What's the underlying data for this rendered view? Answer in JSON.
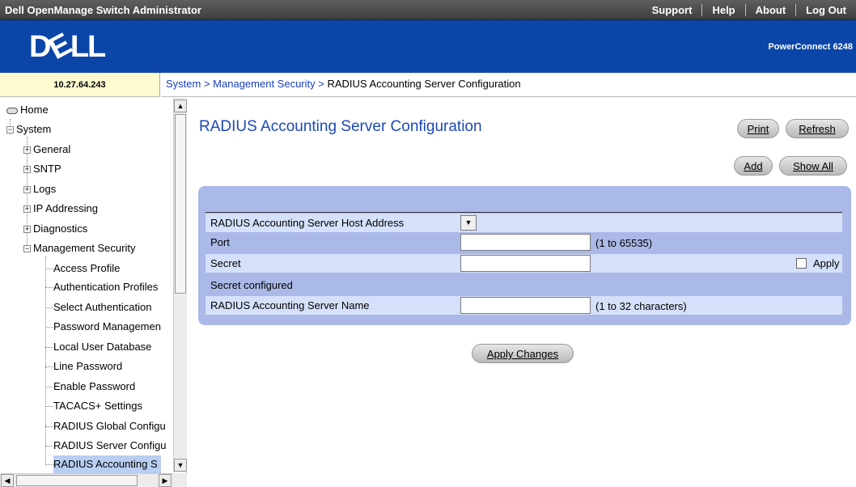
{
  "header": {
    "app_title": "Dell OpenManage Switch Administrator",
    "links": [
      "Support",
      "Help",
      "About",
      "Log Out"
    ]
  },
  "banner": {
    "logo": "DELL",
    "product": "PowerConnect 6248"
  },
  "address": {
    "ip": "10.27.64.243"
  },
  "breadcrumb": {
    "system": "System",
    "sep1": " > ",
    "security": "Management Security",
    "sep2": " > ",
    "current": "RADIUS Accounting Server Configuration"
  },
  "sidebar": {
    "home": "Home",
    "system": "System",
    "groups": [
      "General",
      "SNTP",
      "Logs",
      "IP Addressing",
      "Diagnostics",
      "Management Security"
    ],
    "children": [
      "Access Profile",
      "Authentication Profiles",
      "Select Authentication",
      "Password Managemen",
      "Local User Database",
      "Line Password",
      "Enable Password",
      "TACACS+ Settings",
      "RADIUS Global Configu",
      "RADIUS Server Configu",
      "RADIUS Accounting S"
    ]
  },
  "main": {
    "title": "RADIUS Accounting Server Configuration",
    "buttons": {
      "print": "Print",
      "refresh": "Refresh",
      "add": "Add",
      "show_all": "Show All",
      "apply_changes": "Apply Changes"
    },
    "form": {
      "host_label": "RADIUS Accounting Server Host Address",
      "port_label": "Port",
      "port_value": "",
      "port_hint": "(1 to 65535)",
      "secret_label": "Secret",
      "secret_value": "",
      "apply_label": "Apply",
      "secret_configured_label": "Secret configured",
      "name_label": "RADIUS Accounting Server Name",
      "name_value": "",
      "name_hint": "(1 to 32 characters)"
    }
  },
  "colors": {
    "banner": "#0b45a8",
    "title": "#1c48b8",
    "panel": "#aab9e7",
    "row_light": "#d5e0fa",
    "ip_box": "#fffbd1"
  }
}
